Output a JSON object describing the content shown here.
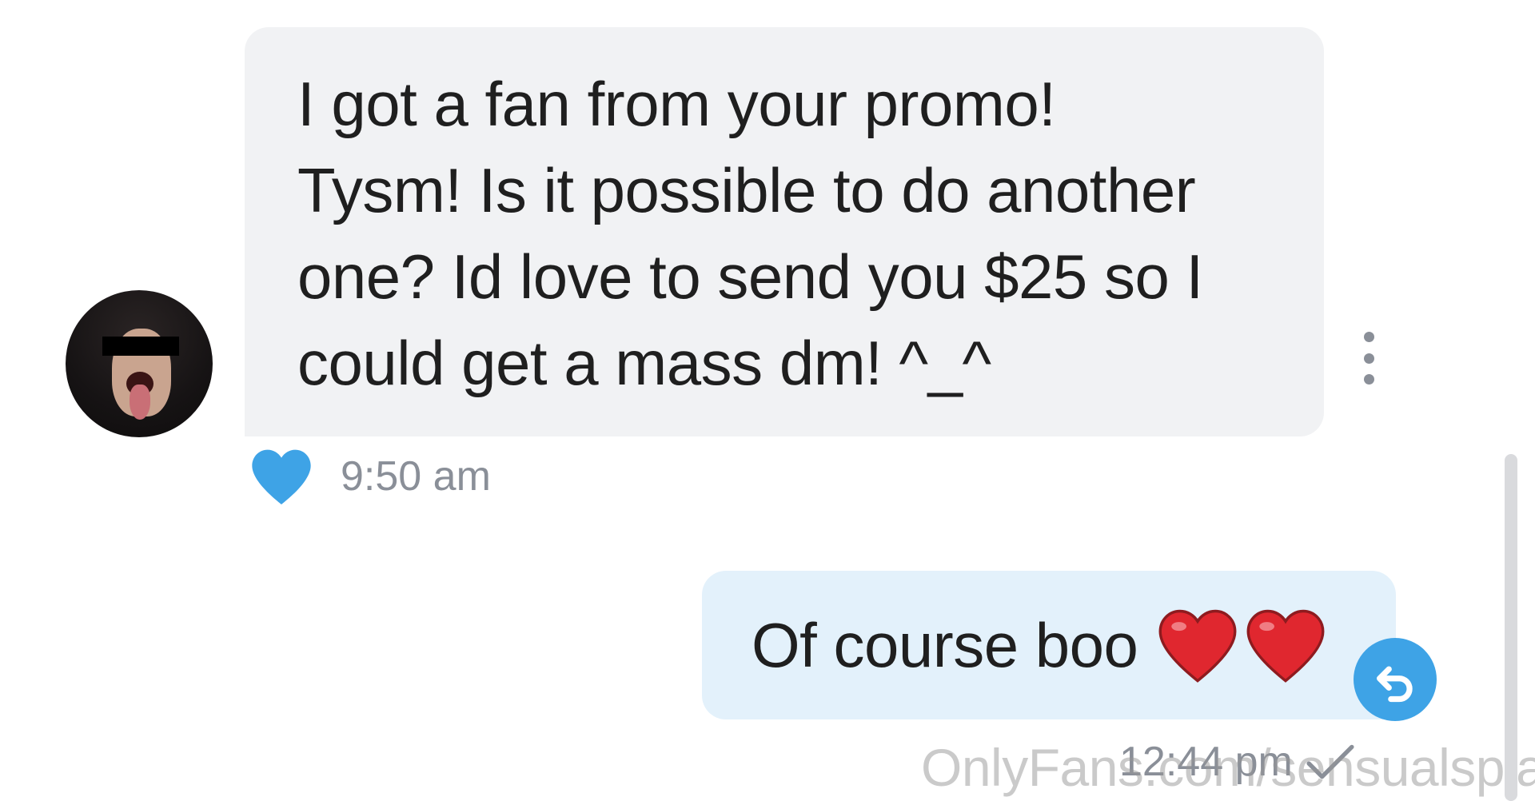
{
  "incoming": {
    "text": "I got a fan from your promo!\nTysm! Is it possible to do another\none? Id love to send you $25 so I\ncould get a mass dm! ^_^",
    "time": "9:50 am",
    "liked": true,
    "avatar_icon": "user-avatar-photo",
    "more_icon": "more-vertical-icon",
    "like_icon": "heart-icon",
    "like_color": "#3ea3e6"
  },
  "outgoing": {
    "text": "Of course boo",
    "emoji": "❤️❤️",
    "time": "12:44 pm",
    "status_icon": "check-icon",
    "undo_icon": "undo-icon",
    "accent": "#3ea3e6"
  },
  "watermark": "OnlyFans.com/sensualsplash"
}
